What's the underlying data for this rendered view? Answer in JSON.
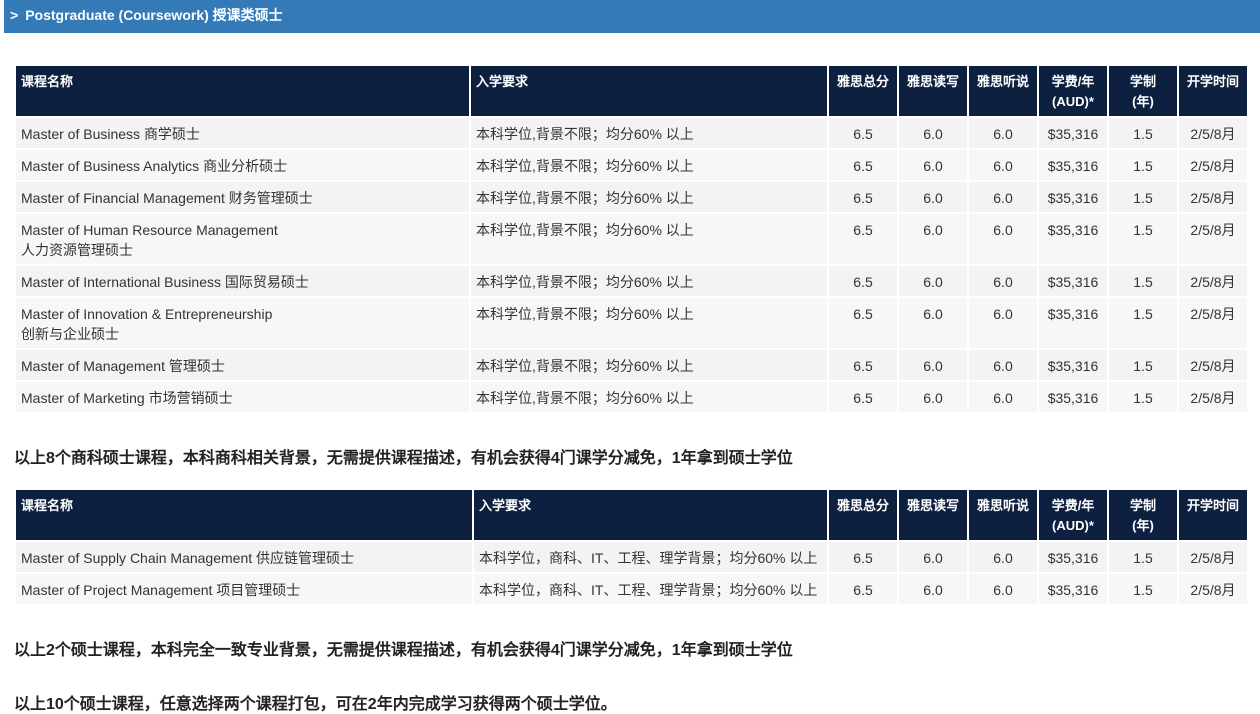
{
  "section": {
    "chevron": ">",
    "title": "Postgraduate (Coursework) 授课类硕士"
  },
  "headers": {
    "name": "课程名称",
    "requirement": "入学要求",
    "ielts_total": "雅思总分",
    "ielts_rw": "雅思读写",
    "ielts_ls": "雅思听说",
    "fee_line1": "学费/年",
    "fee_line2": "(AUD)*",
    "duration_line1": "学制",
    "duration_line2": "(年)",
    "intake": "开学时间"
  },
  "table1": {
    "rows": [
      {
        "name": "Master of Business 商学硕士",
        "name2": "",
        "req": "本科学位,背景不限；均分60% 以上",
        "ielts": "6.5",
        "rw": "6.0",
        "ls": "6.0",
        "fee": "$35,316",
        "duration": "1.5",
        "intake": "2/5/8月"
      },
      {
        "name": "Master of Business Analytics 商业分析硕士",
        "name2": "",
        "req": "本科学位,背景不限；均分60% 以上",
        "ielts": "6.5",
        "rw": "6.0",
        "ls": "6.0",
        "fee": "$35,316",
        "duration": "1.5",
        "intake": "2/5/8月"
      },
      {
        "name": "Master of Financial Management 财务管理硕士",
        "name2": "",
        "req": "本科学位,背景不限；均分60% 以上",
        "ielts": "6.5",
        "rw": "6.0",
        "ls": "6.0",
        "fee": "$35,316",
        "duration": "1.5",
        "intake": "2/5/8月"
      },
      {
        "name": "Master of Human Resource Management",
        "name2": "人力资源管理硕士",
        "req": "本科学位,背景不限；均分60% 以上",
        "ielts": "6.5",
        "rw": "6.0",
        "ls": "6.0",
        "fee": "$35,316",
        "duration": "1.5",
        "intake": "2/5/8月"
      },
      {
        "name": "Master of International Business 国际贸易硕士",
        "name2": "",
        "req": "本科学位,背景不限；均分60% 以上",
        "ielts": "6.5",
        "rw": "6.0",
        "ls": "6.0",
        "fee": "$35,316",
        "duration": "1.5",
        "intake": "2/5/8月"
      },
      {
        "name": "Master of Innovation & Entrepreneurship",
        "name2": "创新与企业硕士",
        "req": "本科学位,背景不限；均分60% 以上",
        "ielts": "6.5",
        "rw": "6.0",
        "ls": "6.0",
        "fee": "$35,316",
        "duration": "1.5",
        "intake": "2/5/8月"
      },
      {
        "name": "Master of Management 管理硕士",
        "name2": "",
        "req": "本科学位,背景不限；均分60% 以上",
        "ielts": "6.5",
        "rw": "6.0",
        "ls": "6.0",
        "fee": "$35,316",
        "duration": "1.5",
        "intake": "2/5/8月"
      },
      {
        "name": "Master of Marketing 市场营销硕士",
        "name2": "",
        "req": "本科学位,背景不限；均分60% 以上",
        "ielts": "6.5",
        "rw": "6.0",
        "ls": "6.0",
        "fee": "$35,316",
        "duration": "1.5",
        "intake": "2/5/8月"
      }
    ]
  },
  "note1": "以上8个商科硕士课程，本科商科相关背景，无需提供课程描述，有机会获得4门课学分减免，1年拿到硕士学位",
  "table2": {
    "rows": [
      {
        "name": "Master of Supply Chain Management 供应链管理硕士",
        "name2": "",
        "req": "本科学位，商科、IT、工程、理学背景；均分60% 以上",
        "ielts": "6.5",
        "rw": "6.0",
        "ls": "6.0",
        "fee": "$35,316",
        "duration": "1.5",
        "intake": "2/5/8月"
      },
      {
        "name": "Master of Project Management 项目管理硕士",
        "name2": "",
        "req": "本科学位，商科、IT、工程、理学背景；均分60% 以上",
        "ielts": "6.5",
        "rw": "6.0",
        "ls": "6.0",
        "fee": "$35,316",
        "duration": "1.5",
        "intake": "2/5/8月"
      }
    ]
  },
  "note2": "以上2个硕士课程，本科完全一致专业背景，无需提供课程描述，有机会获得4门课学分减免，1年拿到硕士学位",
  "note3": "以上10个硕士课程，任意选择两个课程打包，可在2年内完成学习获得两个硕士学位。"
}
